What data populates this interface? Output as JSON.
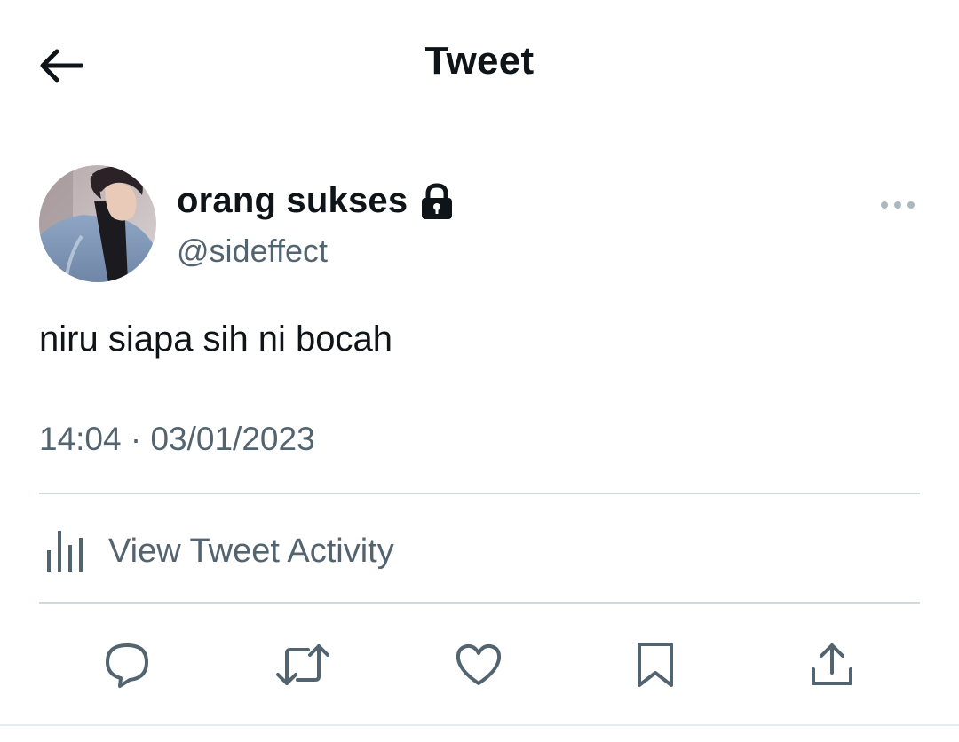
{
  "header": {
    "title": "Tweet",
    "back_icon": "arrow-left-icon"
  },
  "author": {
    "display_name": "orang sukses",
    "handle": "@sideffect",
    "protected_icon": "lock-icon",
    "avatar": "profile-photo",
    "more_icon": "more-horizontal-icon"
  },
  "tweet": {
    "text": "niru siapa sih ni bocah",
    "timestamp": "14:04 · 03/01/2023"
  },
  "activity": {
    "label": "View Tweet Activity",
    "icon": "analytics-bars-icon"
  },
  "actions": [
    {
      "name": "reply",
      "icon": "reply-bubble-icon"
    },
    {
      "name": "retweet",
      "icon": "retweet-icon"
    },
    {
      "name": "like",
      "icon": "heart-icon"
    },
    {
      "name": "bookmark",
      "icon": "bookmark-icon"
    },
    {
      "name": "share",
      "icon": "share-upload-icon"
    }
  ],
  "colors": {
    "text_primary": "#0f1419",
    "text_secondary": "#536471",
    "divider": "#cfd9de",
    "background": "#ffffff"
  }
}
